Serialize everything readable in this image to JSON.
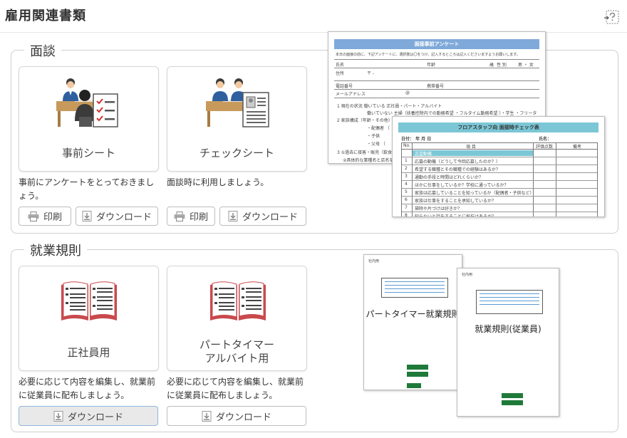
{
  "page": {
    "title": "雇用関連書類"
  },
  "interview": {
    "title": "面談",
    "cards": [
      {
        "label": "事前シート",
        "desc": "事前にアンケートをとっておきましょう。"
      },
      {
        "label": "チェックシート",
        "desc": "面談時に利用しましょう。"
      }
    ],
    "print_label": "印刷",
    "download_label": "ダウンロード"
  },
  "rules": {
    "title": "就業規則",
    "cards": [
      {
        "label": "正社員用",
        "desc": "必要に応じて内容を編集し、就業前に従業員に配布しましょう。"
      },
      {
        "label_line1": "パートタイマー",
        "label_line2": "アルバイト用",
        "desc": "必要に応じて内容を編集し、就業前に従業員に配布しましょう。"
      }
    ],
    "download_label": "ダウンロード"
  },
  "preview": {
    "questionnaire": {
      "title": "面接事前アンケート",
      "intro": "本日の面接の前に、下記アンケートに、選択肢は〇をつけ、記入するところは記入くださいますようお願いします。",
      "fields": [
        "氏名",
        "年齢",
        "歳",
        "性 別",
        "男 ・ 女",
        "住所",
        "〒 -",
        "電話番号",
        "携帯番号",
        "メールアドレス",
        "@"
      ],
      "questions": [
        "1 現在の状況 働いている 正社員・パート・アルバイト",
        "働いていない 主婦（扶養控除内での勤務希望 ・フルタイム勤務希望 ）・学生 ・フリータ",
        "2 家族構成（年齢・その他）",
        "・配偶者 （",
        "・子供",
        "・父母 （",
        "3 ①過去に接客・販売（飲食店",
        "②具体的な業種名と店名を"
      ],
      "header_color": "#7fa9d9"
    },
    "checklist": {
      "title": "フロアスタッフ向 面接時チェック表",
      "date_label": "日付：  年  月  日",
      "name_label": "氏名：",
      "col_no": "No.",
      "col_item": "項 目",
      "col_score": "評価点数",
      "col_note": "備考",
      "section_label": "志望動機",
      "rows": [
        "応募の動機（どうして今回応募したのか？）",
        "希望する職種とその職種での経験はあるか？",
        "通勤の手段と時間はどれくらいか？",
        "ほかに仕事をしているか？学校に通っているか？",
        "家族は応募していることを知っているか（配偶者・子供など）",
        "家族は仕事をすることを承知しているか？",
        "掃除や片づけは好きか？",
        "知らないと話をすることに抵抗はあるか？"
      ],
      "header_color": "#7cc7d6"
    },
    "part_rules": {
      "title": "パートタイマー就業規則",
      "corner": "社内用"
    },
    "staff_rules": {
      "title": "就業規則(従業員)",
      "corner": "社内用"
    }
  },
  "icons": {
    "help": "help-icon",
    "print": "printer-icon",
    "download": "download-icon",
    "interview_pre": "interview-questionnaire-icon",
    "interview_check": "interview-checksheet-icon",
    "book": "open-book-icon"
  },
  "colors": {
    "border": "#cfcfcf",
    "book_red": "#c9494d",
    "person_blue": "#2f5f9e",
    "table_brown": "#c79a5c"
  }
}
